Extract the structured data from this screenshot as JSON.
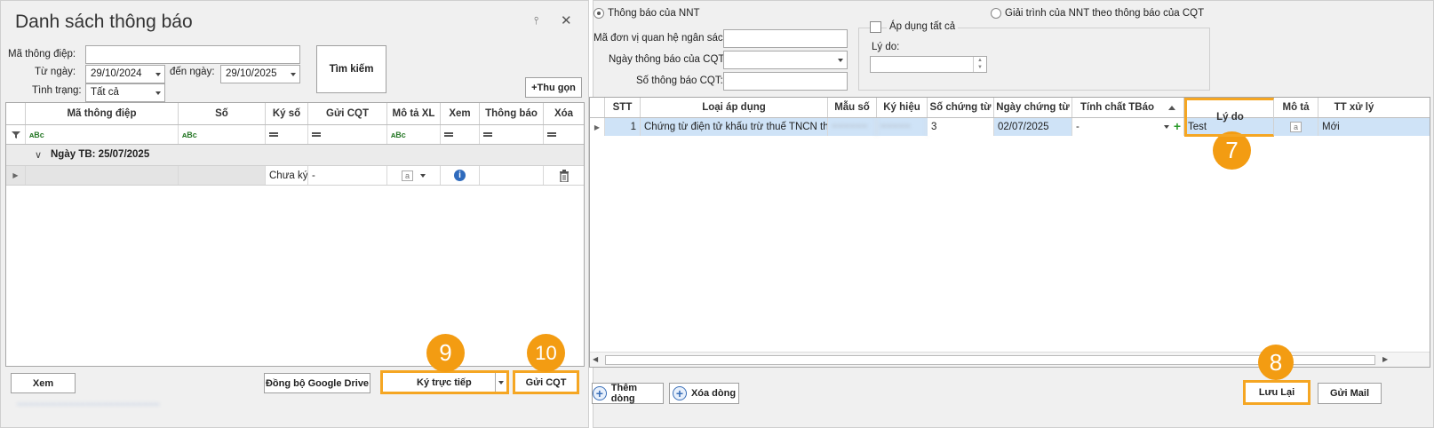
{
  "left": {
    "title": "Danh sách thông báo",
    "filters": {
      "ma_label": "Mã thông điệp:",
      "ma_value": "",
      "tu_label": "Từ ngày:",
      "tu_value": "29/10/2024",
      "den_label": "đến ngày:",
      "den_value": "29/10/2025",
      "tinh_trang_label": "Tình trạng:",
      "tinh_trang_value": "Tất cả"
    },
    "search_label": "Tìm kiếm",
    "collapse_label": "+Thu gọn",
    "columns": [
      "Mã thông điệp",
      "Số",
      "Ký số",
      "Gửi CQT",
      "Mô tả XL",
      "Xem",
      "Thông báo",
      "Xóa"
    ],
    "group_label": "Ngày TB: 25/07/2025",
    "row": {
      "ky_so": "Chưa ký",
      "gui_cqt": "-"
    },
    "buttons": {
      "xem": "Xem",
      "sync": "Đồng bộ Google Drive",
      "ky": "Ký trực tiếp",
      "gui": "Gửi CQT"
    },
    "blurred_footer": "~~~~~~~~~~~~~~~~~~~~~~~~~"
  },
  "right": {
    "radio1": "Thông báo của NNT",
    "radio2": "Giải trình của NNT theo thông báo của CQT",
    "f1_label": "Mã đơn vị quan hệ ngân sách:",
    "f2_label": "Ngày thông báo của CQT:",
    "f3_label": "Số thông báo CQT:",
    "apply_all": "Áp dụng tất cả",
    "ly_do_label": "Lý do:",
    "columns": [
      "STT",
      "Loại áp dụng",
      "Mẫu số",
      "Ký hiệu",
      "Số chứng từ",
      "Ngày chứng từ",
      "Tính chất TBáo",
      "Lý do",
      "Mô tả",
      "TT xử lý"
    ],
    "row": {
      "stt": "1",
      "loai": "Chứng từ điện tử khấu trừ thuế TNCN th...",
      "mau_so": "~~~~~~",
      "ky_hieu": "~~~~~",
      "so_ct": "3",
      "ngay_ct": "02/07/2025",
      "tinh_chat": "-",
      "ly_do": "Test",
      "tt": "Mới"
    },
    "buttons": {
      "them": "Thêm dòng",
      "xoa": "Xóa dòng",
      "luu": "Lưu Lại",
      "mail": "Gửi Mail"
    }
  },
  "badges": {
    "b7": "7",
    "b8": "8",
    "b9": "9",
    "b10": "10"
  },
  "colors": {
    "highlight": "#f5a623",
    "badge": "#f39c12",
    "selected_row": "#cfe3f7"
  }
}
